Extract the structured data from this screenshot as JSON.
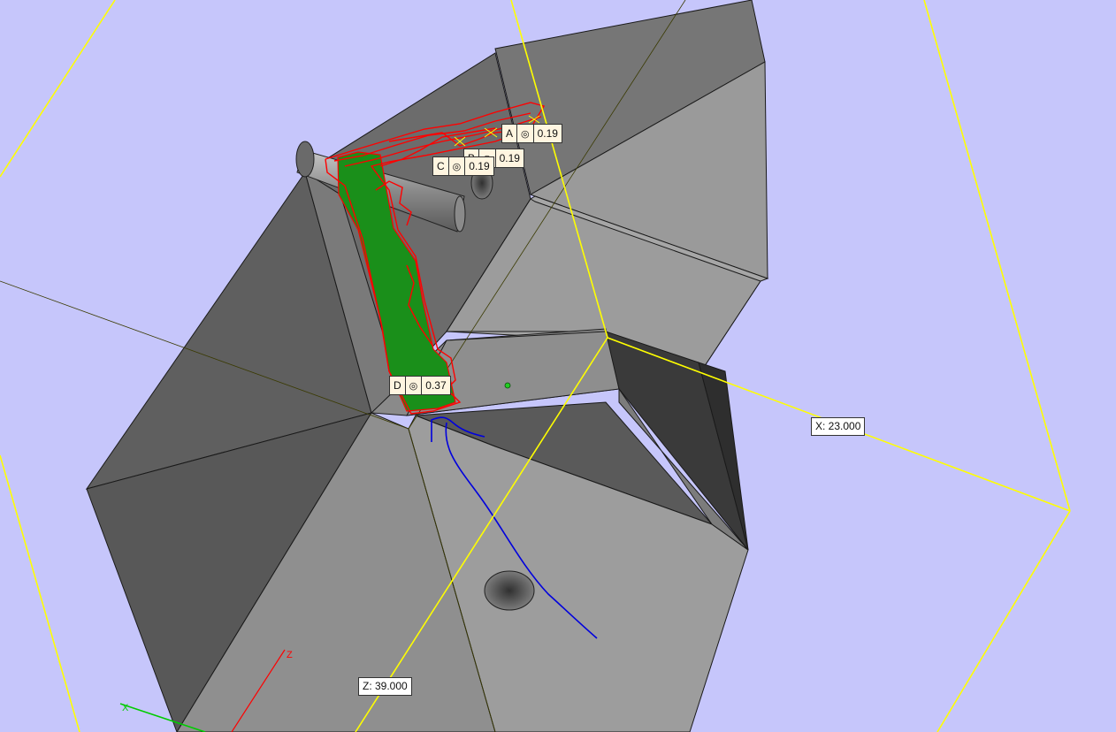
{
  "viewport": {
    "background": "#c6c6fb",
    "bounding_box_color": "#ffff00",
    "profile_color": "#ff0000",
    "region_fill_color": "#1a8f1a",
    "path_color": "#0000dd",
    "origin_marker": "green-dot"
  },
  "tolerance_tags": [
    {
      "id": "A",
      "symbol": "◎",
      "value": "0.19"
    },
    {
      "id": "B",
      "symbol": "◎",
      "value": "0.19"
    },
    {
      "id": "C",
      "symbol": "◎",
      "value": "0.19"
    },
    {
      "id": "D",
      "symbol": "◎",
      "value": "0.37"
    }
  ],
  "dimensions": {
    "x": "X: 23.000",
    "z": "Z: 39.000"
  },
  "triad": {
    "x_label": "X",
    "z_label": "Z"
  }
}
